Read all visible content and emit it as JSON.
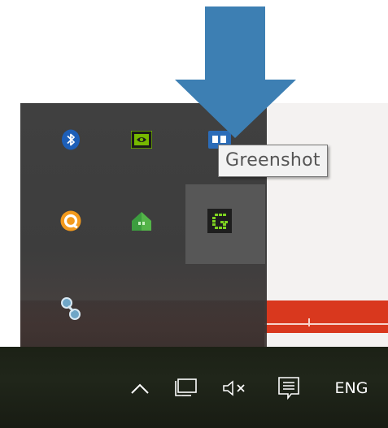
{
  "tooltip": {
    "text": "Greenshot"
  },
  "flyout": {
    "icons": [
      {
        "name": "bluetooth-icon"
      },
      {
        "name": "nvidia-icon"
      },
      {
        "name": "dropbox-icon"
      },
      {
        "name": "avast-icon"
      },
      {
        "name": "home-icon"
      },
      {
        "name": "greenshot-icon"
      },
      {
        "name": "network-link-icon"
      }
    ]
  },
  "taskbar": {
    "show_hidden_icon": "show-hidden-icons-chevron",
    "network_icon": "network-icon",
    "volume_icon": "volume-muted-icon",
    "notifications_icon": "action-center-icon",
    "language": "ENG"
  },
  "colors": {
    "arrow": "#3d7fb3",
    "flyout_bg": "#404040",
    "accent_red": "#d9381e",
    "greenshot_green": "#7ed321"
  }
}
